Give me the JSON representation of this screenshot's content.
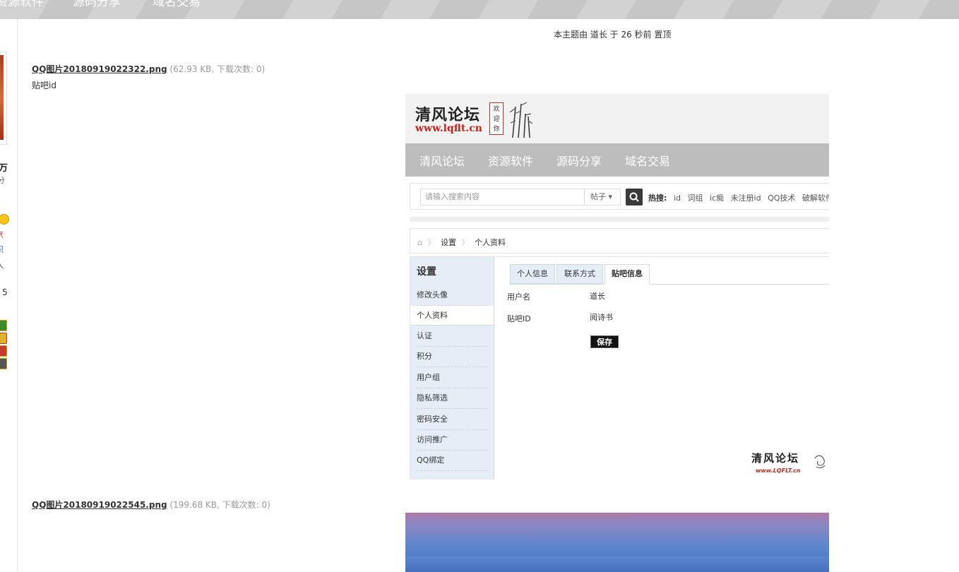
{
  "topnav": {
    "items": [
      "资源软件",
      "源码分享",
      "域名交易"
    ]
  },
  "left_column": {
    "fragments": [
      "万",
      "分",
      "京",
      "积",
      "人",
      "5"
    ]
  },
  "topic_note": "本主题由 道长 于 26 秒前 置顶",
  "attachments": [
    {
      "name": "QQ图片20180919022322.png",
      "meta": "(62.93 KB, 下载次数: 0)",
      "description": "贴吧id"
    },
    {
      "name": "QQ图片20180919022545.png",
      "meta": "(199.68 KB, 下载次数: 0)"
    }
  ],
  "embedded": {
    "logo_title": "清风论坛",
    "logo_url": "www.lqflt.cn",
    "logo_seal": [
      "欢",
      "迎",
      "你"
    ],
    "nav": [
      "清风论坛",
      "资源软件",
      "源码分享",
      "域名交易"
    ],
    "search": {
      "placeholder": "请输入搜索内容",
      "type": "帖子 ▾",
      "hot_label": "热搜:",
      "hot_words": [
        "id",
        "词组",
        "ic痴",
        "未注册id",
        "QQ技术",
        "破解软件"
      ]
    },
    "breadcrumb": [
      "设置",
      "个人资料"
    ],
    "sidebar": {
      "title": "设置",
      "items": [
        "修改头像",
        "个人资料",
        "认证",
        "积分",
        "用户组",
        "隐私筛选",
        "密码安全",
        "访问推广",
        "QQ绑定"
      ]
    },
    "tabs": [
      "个人信息",
      "联系方式",
      "贴吧信息"
    ],
    "form": {
      "username_label": "用户名",
      "username_value": "道长",
      "tieba_label": "贴吧ID",
      "tieba_value": "阅诗书",
      "save": "保存"
    },
    "watermark": "清风论坛",
    "watermark_url": "www.LQFLT.cn"
  },
  "colors": {
    "accent_red": "#c0271d",
    "nav_gray": "#bdbdbd",
    "sidebar_blue": "#e5eef7"
  }
}
